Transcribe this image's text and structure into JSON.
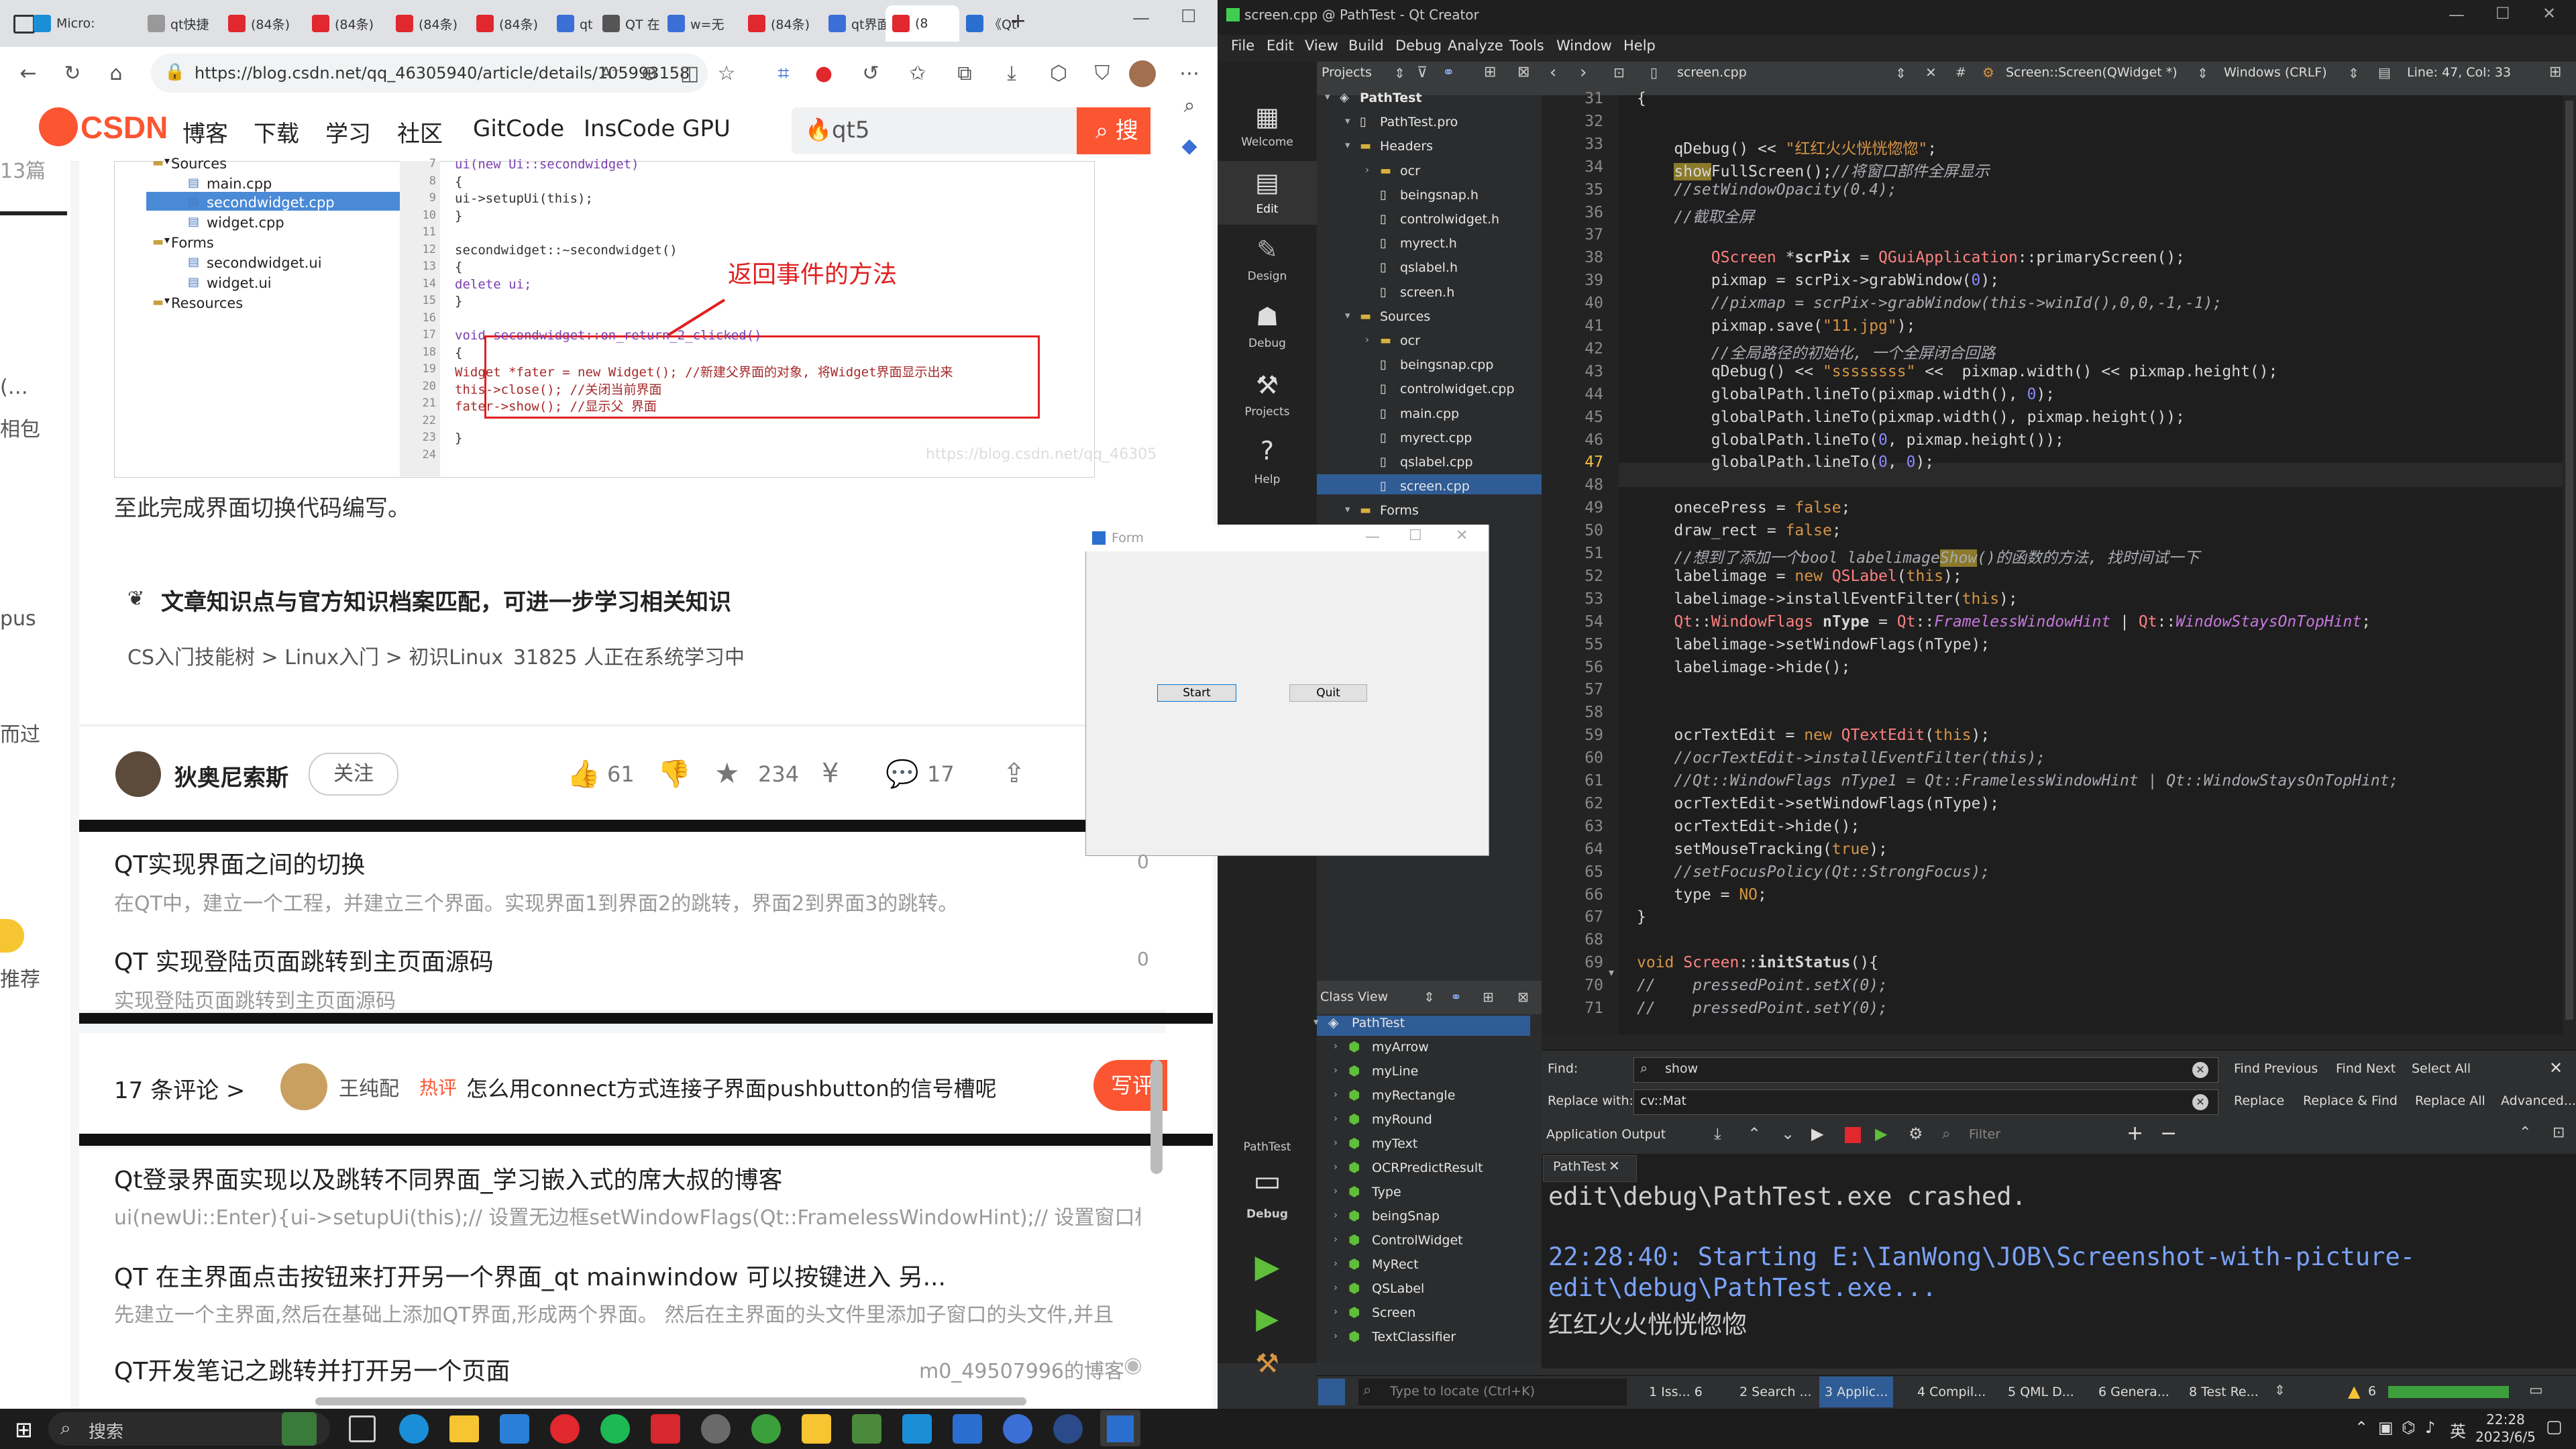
{
  "browser": {
    "tabs": [
      {
        "label": "Micro:"
      },
      {
        "label": "qt快捷"
      },
      {
        "label": "(84条)"
      },
      {
        "label": "(84条)"
      },
      {
        "label": "(84条)"
      },
      {
        "label": "(84条)"
      },
      {
        "label": "qt 在"
      },
      {
        "label": "QT 在"
      },
      {
        "label": "w=无"
      },
      {
        "label": "(84条)"
      },
      {
        "label": "qt界面"
      },
      {
        "label": "(8"
      },
      {
        "label": "《Qt"
      }
    ],
    "url": "https://blog.csdn.net/qq_46305940/article/details/105993158",
    "font_label": "A⁺"
  },
  "csdn": {
    "logo": "CSDN",
    "nav": [
      "博客",
      "下载",
      "学习",
      "社区",
      "GitCode",
      "InsCode GPU"
    ],
    "search_value": "qt5",
    "search_btn": "搜",
    "left_strip": [
      "13篇",
      "(…",
      "相包",
      "pus",
      "而过",
      "推荐"
    ]
  },
  "article": {
    "tree": [
      {
        "label": "Sources",
        "level": 0
      },
      {
        "label": "main.cpp",
        "level": 1
      },
      {
        "label": "secondwidget.cpp",
        "level": 1
      },
      {
        "label": "widget.cpp",
        "level": 1
      },
      {
        "label": "Forms",
        "level": 0
      },
      {
        "label": "secondwidget.ui",
        "level": 1
      },
      {
        "label": "widget.ui",
        "level": 1
      },
      {
        "label": "Resources",
        "level": 0
      }
    ],
    "code_lines": [
      {
        "ln": "7",
        "text": "    ui(new Ui::secondwidget)"
      },
      {
        "ln": "8",
        "text": "{"
      },
      {
        "ln": "9",
        "text": "    ui->setupUi(this);"
      },
      {
        "ln": "10",
        "text": "}"
      },
      {
        "ln": "11",
        "text": ""
      },
      {
        "ln": "12",
        "text": "secondwidget::~secondwidget()"
      },
      {
        "ln": "13",
        "text": "{"
      },
      {
        "ln": "14",
        "text": "    delete ui;"
      },
      {
        "ln": "15",
        "text": "}"
      },
      {
        "ln": "16",
        "text": ""
      },
      {
        "ln": "17",
        "text": "void secondwidget::on_return_2_clicked()"
      },
      {
        "ln": "18",
        "text": "{"
      },
      {
        "ln": "19",
        "text": "    Widget *fater = new Widget(); //新建父界面的对象, 将Widget界面显示出来"
      },
      {
        "ln": "20",
        "text": "    this->close(); //关闭当前界面"
      },
      {
        "ln": "21",
        "text": "    fater->show(); //显示父 界面"
      },
      {
        "ln": "22",
        "text": ""
      },
      {
        "ln": "23",
        "text": "}"
      },
      {
        "ln": "24",
        "text": ""
      }
    ],
    "annotation": "返回事件的方法",
    "watermark": "https://blog.csdn.net/qq_46305",
    "summary": "至此完成界面切换代码编写。",
    "knowledge_title": "文章知识点与官方知识档案匹配，可进一步学习相关知识",
    "knowledge_path": "CS入门技能树 > Linux入门 > 初识Linux",
    "knowledge_count": "31825 人正在系统学习中",
    "author": "狄奥尼索斯",
    "follow": "关注",
    "likes": "61",
    "stars": "234",
    "comments_count": "17"
  },
  "related": [
    {
      "title": "QT实现界面之间的切换",
      "desc": "在QT中，建立一个工程，并建立三个界面。实现界面1到界面2的跳转，界面2到界面3的跳转。",
      "side": "0"
    },
    {
      "title": "QT 实现登陆页面跳转到主页面源码",
      "desc": "实现登陆页面跳转到主页面源码",
      "side": "0"
    }
  ],
  "comments": {
    "label": "17 条评论 >",
    "commenter": "王纯配",
    "hot": "热评",
    "text": "怎么用connect方式连接子界面pushbutton的信号槽呢",
    "write": "写评"
  },
  "related2": [
    {
      "title": "Qt登录界面实现以及跳转不同界面_学习嵌入式的席大叔的博客",
      "desc": "ui(newUi::Enter){ui->setupUi(this);// 设置无边框setWindowFlags(Qt::FramelessWindowHint);// 设置窗口标题this"
    },
    {
      "title": "QT 在主界面点击按钮来打开另一个界面_qt mainwindow 可以按键进入 另...",
      "desc": "先建立一个主界面,然后在基础上添加QT界面,形成两个界面。 然后在主界面的头文件里添加子窗口的头文件,并且"
    },
    {
      "title": "QT开发笔记之跳转并打开另一个页面",
      "desc": "",
      "side": "m0_49507996的博客"
    }
  ],
  "qt": {
    "title": "screen.cpp @ PathTest - Qt Creator",
    "menu": [
      "File",
      "Edit",
      "View",
      "Build",
      "Debug",
      "Analyze",
      "Tools",
      "Window",
      "Help"
    ],
    "modes": [
      "Welcome",
      "Edit",
      "Design",
      "Debug",
      "Projects",
      "Help"
    ],
    "projects_label": "Projects",
    "file_name": "screen.cpp",
    "symbol": "Screen::Screen(QWidget *)",
    "line_ending": "Windows (CRLF)",
    "position": "Line: 47, Col: 33",
    "tree": [
      {
        "label": "PathTest",
        "level": 0
      },
      {
        "label": "PathTest.pro",
        "level": 1
      },
      {
        "label": "Headers",
        "level": 1
      },
      {
        "label": "ocr",
        "level": 2
      },
      {
        "label": "beingsnap.h",
        "level": 2
      },
      {
        "label": "controlwidget.h",
        "level": 2
      },
      {
        "label": "myrect.h",
        "level": 2
      },
      {
        "label": "qslabel.h",
        "level": 2
      },
      {
        "label": "screen.h",
        "level": 2
      },
      {
        "label": "Sources",
        "level": 1
      },
      {
        "label": "ocr",
        "level": 2
      },
      {
        "label": "beingsnap.cpp",
        "level": 2
      },
      {
        "label": "controlwidget.cpp",
        "level": 2
      },
      {
        "label": "main.cpp",
        "level": 2
      },
      {
        "label": "myrect.cpp",
        "level": 2
      },
      {
        "label": "qslabel.cpp",
        "level": 2
      },
      {
        "label": "screen.cpp",
        "level": 2
      },
      {
        "label": "Forms",
        "level": 1
      }
    ],
    "class_view_label": "Class View",
    "classes": [
      "PathTest",
      "myArrow",
      "myLine",
      "myRectangle",
      "myRound",
      "myText",
      "OCRPredictResult",
      "Type",
      "beingSnap",
      "ControlWidget",
      "MyRect",
      "QSLabel",
      "Screen",
      "TextClassifier"
    ],
    "find_label": "Find:",
    "find_value": "show",
    "replace_label": "Replace with:",
    "replace_value": "cv::Mat",
    "find_buttons": [
      "Find Previous",
      "Find Next",
      "Select All",
      "Replace",
      "Replace & Find",
      "Replace All",
      "Advanced..."
    ],
    "output_label": "Application Output",
    "filter_placeholder": "Filter",
    "output_tab": "PathTest",
    "output_lines": [
      "edit\\debug\\PathTest.exe crashed.",
      "",
      "22:28:40: Starting E:\\IanWong\\JOB\\Screenshot-with-picture-",
      "edit\\debug\\PathTest.exe...",
      "红红火火恍恍惚惚"
    ],
    "kit_label": "PathTest",
    "kit_mode": "Debug",
    "locate_placeholder": "Type to locate (Ctrl+K)",
    "status_tabs": [
      "1 Iss... 6",
      "2 Search ...",
      "3 Applic...",
      "4 Compil...",
      "5 QML D...",
      "6 Genera...",
      "8 Test Re..."
    ],
    "warning_count": "6"
  },
  "form": {
    "title": "Form",
    "start": "Start",
    "quit": "Quit"
  },
  "taskbar": {
    "search": "搜索",
    "time": "22:28",
    "date": "2023/6/5",
    "lang": "英"
  }
}
